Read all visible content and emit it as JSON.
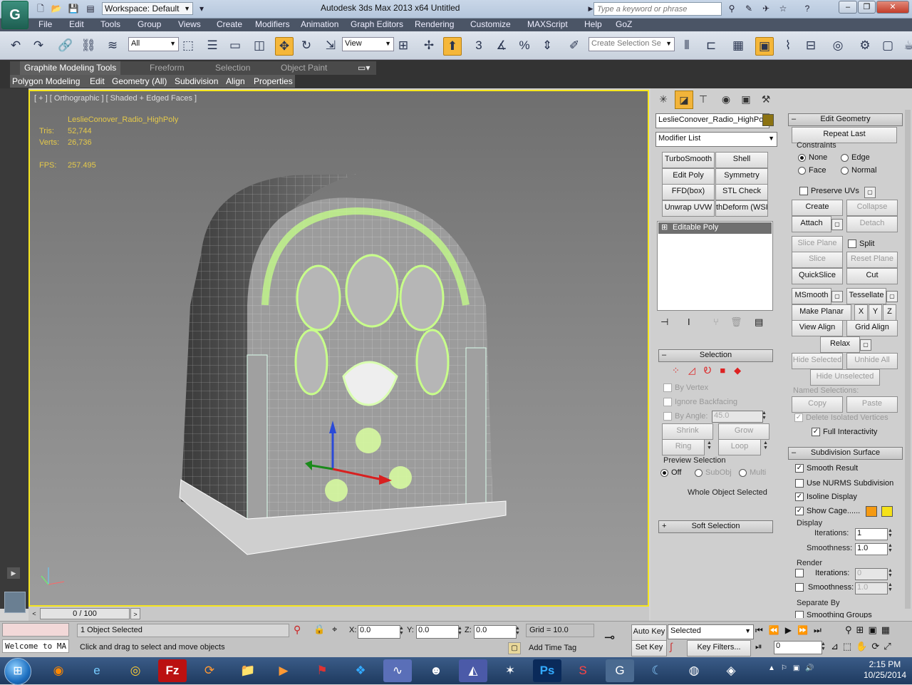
{
  "window": {
    "title": "Autodesk 3ds Max  2013 x64     Untitled",
    "workspace": "Workspace: Default",
    "search_placeholder": "Type a keyword or phrase"
  },
  "menu": [
    "File",
    "Edit",
    "Tools",
    "Group",
    "Views",
    "Create",
    "Modifiers",
    "Animation",
    "Graph Editors",
    "Rendering",
    "Customize",
    "MAXScript",
    "Help",
    "GoZ"
  ],
  "toolbar": {
    "selection_filter": "All",
    "ref_coord": "View",
    "named_selection": "Create Selection Se"
  },
  "ribbon": {
    "tabs": [
      "Graphite Modeling Tools",
      "Freeform",
      "Selection",
      "Object Paint"
    ],
    "sub": [
      "Polygon Modeling",
      "Edit",
      "Geometry (All)",
      "Subdivision",
      "Align",
      "Properties"
    ]
  },
  "viewport": {
    "label": "[ + ] [ Orthographic ] [ Shaded + Edged Faces ]",
    "object_name": "LeslieConover_Radio_HighPoly",
    "tris_label": "Tris:",
    "tris": "52,744",
    "verts_label": "Verts:",
    "verts": "26,736",
    "fps_label": "FPS:",
    "fps": "257.495"
  },
  "panel": {
    "object_name": "LeslieConover_Radio_HighPol",
    "modifier_list": "Modifier List",
    "modifier_buttons": [
      "TurboSmooth",
      "Shell",
      "Edit Poly",
      "Symmetry",
      "FFD(box)",
      "STL Check",
      "Unwrap UVW",
      "thDeform (WSI"
    ],
    "stack_item": "Editable Poly",
    "selection": {
      "title": "Selection",
      "by_vertex": "By Vertex",
      "ignore_backfacing": "Ignore Backfacing",
      "by_angle": "By Angle:",
      "angle_value": "45.0",
      "shrink": "Shrink",
      "grow": "Grow",
      "ring": "Ring",
      "loop": "Loop",
      "preview": "Preview Selection",
      "preview_options": [
        "Off",
        "SubObj",
        "Multi"
      ],
      "status": "Whole Object Selected"
    },
    "soft_selection": "Soft Selection",
    "edit_geometry": {
      "title": "Edit Geometry",
      "repeat_last": "Repeat Last",
      "constraints": "Constraints",
      "constraint_options": [
        "None",
        "Edge",
        "Face",
        "Normal"
      ],
      "preserve_uvs": "Preserve UVs",
      "create": "Create",
      "collapse": "Collapse",
      "attach": "Attach",
      "detach": "Detach",
      "slice_plane": "Slice Plane",
      "split": "Split",
      "slice": "Slice",
      "reset_plane": "Reset Plane",
      "quickslice": "QuickSlice",
      "cut": "Cut",
      "msmooth": "MSmooth",
      "tessellate": "Tessellate",
      "make_planar": "Make Planar",
      "x": "X",
      "y": "Y",
      "z": "Z",
      "view_align": "View Align",
      "grid_align": "Grid Align",
      "relax": "Relax",
      "hide_selected": "Hide Selected",
      "unhide_all": "Unhide All",
      "hide_unselected": "Hide Unselected",
      "named_selections": "Named Selections:",
      "copy": "Copy",
      "paste": "Paste",
      "delete_isolated": "Delete Isolated Vertices",
      "full_interactivity": "Full Interactivity"
    },
    "subdivision": {
      "title": "Subdivision Surface",
      "smooth_result": "Smooth Result",
      "use_nurms": "Use NURMS Subdivision",
      "isoline": "Isoline Display",
      "show_cage": "Show Cage......",
      "cage_colors": [
        "#f59a12",
        "#f5e21a"
      ],
      "display": "Display",
      "iterations_label": "Iterations:",
      "iterations": "1",
      "smoothness_label": "Smoothness:",
      "smoothness": "1.0",
      "render": "Render",
      "render_iterations": "0",
      "render_smoothness": "1.0",
      "separate_by": "Separate By",
      "smoothing_groups": "Smoothing Groups"
    }
  },
  "timeline": {
    "frame": "0 / 100"
  },
  "status": {
    "listener": "Welcome to MA",
    "objects_selected": "1 Object Selected",
    "prompt": "Click and drag to select and move objects",
    "x_label": "X:",
    "x": "0.0",
    "y_label": "Y:",
    "y": "0.0",
    "z_label": "Z:",
    "z": "0.0",
    "grid": "Grid = 10.0",
    "add_time_tag": "Add Time Tag",
    "auto_key": "Auto Key",
    "set_key": "Set Key",
    "key_mode": "Selected",
    "key_filters": "Key Filters...",
    "current_frame": "0"
  },
  "taskbar": {
    "time": "2:15 PM",
    "date": "10/25/2014"
  }
}
